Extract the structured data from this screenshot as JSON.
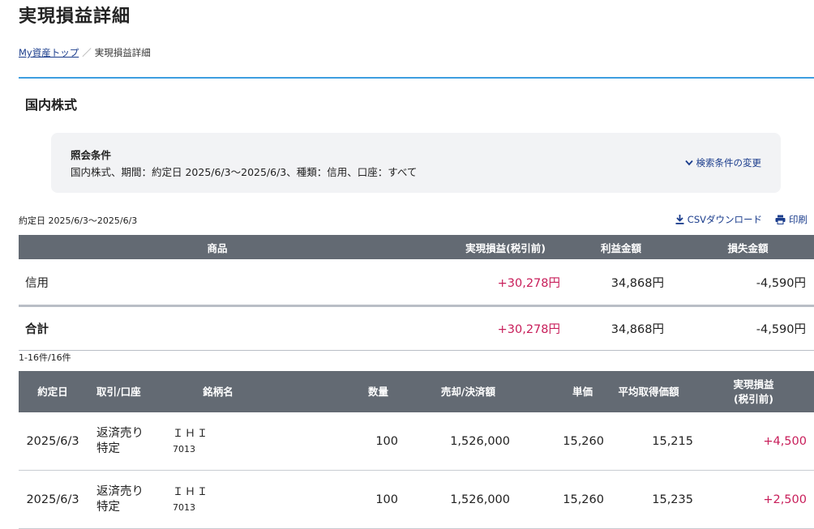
{
  "page_title": "実現損益詳細",
  "breadcrumb": {
    "link": "My資産トップ",
    "separator": "／",
    "current": "実現損益詳細"
  },
  "section_title": "国内株式",
  "conditions": {
    "label": "照会条件",
    "value": "国内株式、期間：約定日 2025/6/3～2025/6/3、種類：信用、口座：すべて",
    "change_label": "検索条件の変更"
  },
  "period_label": "約定日 2025/6/3～2025/6/3",
  "tools": {
    "csv_label": "CSVダウンロード",
    "print_label": "印刷"
  },
  "summary_table": {
    "headers": [
      "商品",
      "実現損益(税引前)",
      "利益金額",
      "損失金額"
    ],
    "rows": [
      {
        "product": "信用",
        "realized": "+30,278円",
        "profit": "34,868円",
        "loss": "-4,590円"
      }
    ],
    "total": {
      "product": "合計",
      "realized": "+30,278円",
      "profit": "34,868円",
      "loss": "-4,590円"
    }
  },
  "count_label": "1-16件/16件",
  "detail_table": {
    "headers": [
      "約定日",
      "取引/口座",
      "銘柄名",
      "数量",
      "売却/決済額",
      "単価",
      "平均取得価額",
      "実現損益",
      "(税引前)"
    ],
    "rows": [
      {
        "date": "2025/6/3",
        "trade": "返済売り",
        "account": "特定",
        "name": "ＩＨＩ",
        "code": "7013",
        "qty": "100",
        "amount": "1,526,000",
        "price": "15,260",
        "avg": "15,215",
        "pl": "+4,500"
      },
      {
        "date": "2025/6/3",
        "trade": "返済売り",
        "account": "特定",
        "name": "ＩＨＩ",
        "code": "7013",
        "qty": "100",
        "amount": "1,526,000",
        "price": "15,260",
        "avg": "15,235",
        "pl": "+2,500"
      }
    ]
  },
  "colors": {
    "header_bg": "#636a73",
    "accent_blue": "#3d9ee0",
    "link": "#1a3c8c",
    "positive": "#c81e5a"
  },
  "icons": {
    "change": "chevron-down-icon",
    "csv": "download-icon",
    "print": "printer-icon"
  }
}
